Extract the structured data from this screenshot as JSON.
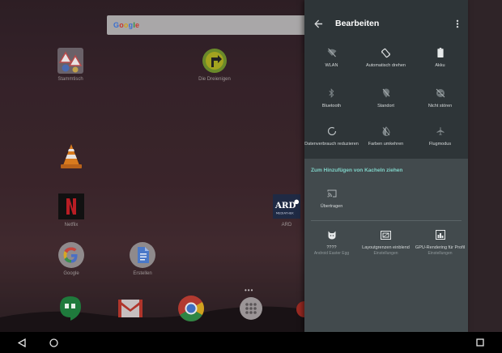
{
  "home": {
    "search_logo": [
      "G",
      "o",
      "o",
      "g",
      "l",
      "e"
    ],
    "apps": [
      {
        "label": "Stammtisch",
        "icon": "signs-icon"
      },
      {
        "label": "Die Dreienigen",
        "icon": "green-arrow-icon"
      },
      {
        "label": "",
        "icon": "vlc-cone-icon"
      },
      {
        "label": "Netflix",
        "icon": "netflix-icon"
      },
      {
        "label": "ARD",
        "icon": "ard-mediathek-icon"
      },
      {
        "label": "Google",
        "icon": "google-icon"
      },
      {
        "label": "Erstellen",
        "icon": "docs-icon"
      }
    ],
    "ard_text": "ARD",
    "ard_sub": "MEDIATHEK",
    "dock": [
      {
        "icon": "hangouts-icon"
      },
      {
        "icon": "gmail-icon"
      },
      {
        "icon": "chrome-icon"
      },
      {
        "icon": "app-drawer-icon"
      }
    ],
    "page_dots": "•••"
  },
  "panel": {
    "title": "Bearbeiten",
    "active_tiles": [
      {
        "label": "WLAN",
        "icon": "wifi-off-icon"
      },
      {
        "label": "Automatisch drehen",
        "icon": "auto-rotate-icon"
      },
      {
        "label": "Akku",
        "icon": "battery-icon"
      },
      {
        "label": "Bluetooth",
        "icon": "bluetooth-icon"
      },
      {
        "label": "Standort",
        "icon": "location-off-icon"
      },
      {
        "label": "Nicht stören",
        "icon": "dnd-icon"
      },
      {
        "label": "Datenverbrauch reduzieren",
        "icon": "data-saver-icon"
      },
      {
        "label": "Farben umkehren",
        "icon": "invert-colors-icon"
      },
      {
        "label": "Flugmodus",
        "icon": "airplane-icon"
      }
    ],
    "add_title": "Zum Hinzufügen von Kacheln ziehen",
    "available_tiles": [
      {
        "label": "Übertragen",
        "sub": "",
        "icon": "cast-icon"
      },
      {
        "label": "????",
        "sub": "Android Easter Egg",
        "icon": "cat-icon"
      },
      {
        "label": "Layoutgrenzen einblend",
        "sub": "Einstellungen",
        "icon": "layout-bounds-icon"
      },
      {
        "label": "GPU-Rendering für Profil",
        "sub": "Einstellungen",
        "icon": "gpu-profile-icon"
      }
    ]
  },
  "colors": {
    "panel_bg": "#2e3538",
    "panel_add_bg": "#424a4d",
    "accent": "#7fd3c8"
  }
}
